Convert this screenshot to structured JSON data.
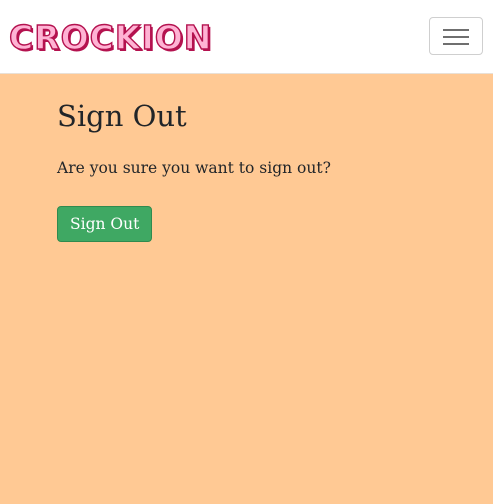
{
  "navbar": {
    "brand": "CROCKION",
    "toggle_icon": "hamburger-menu-icon"
  },
  "main": {
    "title": "Sign Out",
    "message": "Are you sure you want to sign out?",
    "sign_out_button": "Sign Out"
  },
  "colors": {
    "page_background": "#ffc994",
    "brand": "#b4124f",
    "button": "#3fa863"
  }
}
